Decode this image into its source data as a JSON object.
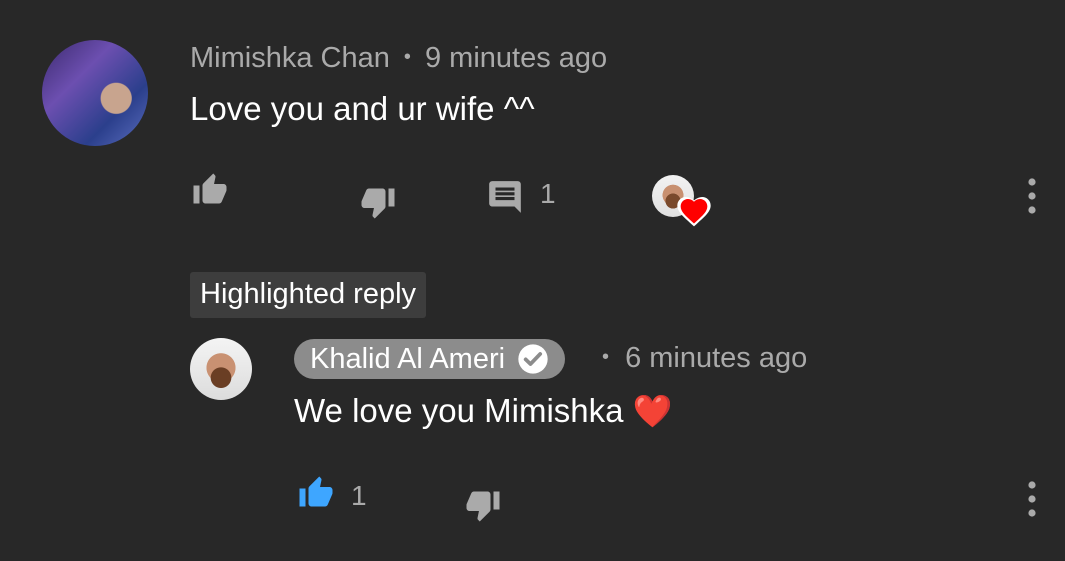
{
  "comment": {
    "author": "Mimishka Chan",
    "separator": "•",
    "time": "9 minutes ago",
    "text": "Love you and ur wife ^^",
    "reply_count": "1",
    "icons": {
      "like": "thumb-up-icon",
      "dislike": "thumb-down-icon",
      "reply": "comment-icon",
      "creator_heart": "heart-badge-icon",
      "more": "more-vert-icon"
    }
  },
  "highlighted_label": "Highlighted reply",
  "reply": {
    "author": "Khalid Al Ameri",
    "verified_icon": "verified-check-icon",
    "separator": "•",
    "time": "6 minutes ago",
    "text": "We love you Mimishka",
    "emoji": "❤️",
    "like_count": "1"
  },
  "colors": {
    "background": "#282828",
    "secondary_text": "#aaaaaa",
    "liked_blue": "#3ea6ff",
    "heart_red": "#ff0000",
    "author_pill": "#8c8c8c"
  }
}
